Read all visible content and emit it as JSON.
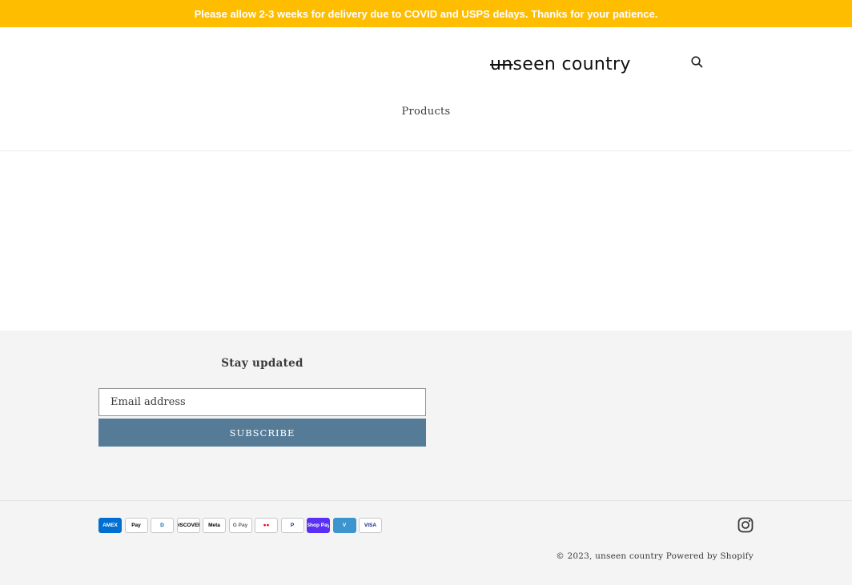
{
  "announcement": {
    "text": "Please allow 2-3 weeks for delivery due to COVID and USPS delays. Thanks for your patience."
  },
  "header": {
    "logo_prefix": "un",
    "logo_suffix": "seen country",
    "search_icon": "search-icon",
    "nav": [
      {
        "label": "Products"
      }
    ]
  },
  "footer": {
    "newsletter": {
      "title": "Stay updated",
      "email_placeholder": "Email address",
      "subscribe_label": "SUBSCRIBE"
    },
    "payment_methods": [
      {
        "label": "AMEX",
        "name": "American Express",
        "bg": "#016fd0",
        "fg": "#ffffff"
      },
      {
        "label": "Pay",
        "name": "Apple Pay",
        "bg": "#ffffff",
        "fg": "#000000"
      },
      {
        "label": "D",
        "name": "Diners Club",
        "bg": "#ffffff",
        "fg": "#0165ac"
      },
      {
        "label": "DISCOVER",
        "name": "Discover",
        "bg": "#ffffff",
        "fg": "#000000"
      },
      {
        "label": "Meta",
        "name": "Meta Pay",
        "bg": "#ffffff",
        "fg": "#000000"
      },
      {
        "label": "G Pay",
        "name": "Google Pay",
        "bg": "#ffffff",
        "fg": "#5f6368"
      },
      {
        "label": "●●",
        "name": "Mastercard",
        "bg": "#ffffff",
        "fg": "#eb001b"
      },
      {
        "label": "P",
        "name": "PayPal",
        "bg": "#ffffff",
        "fg": "#003087"
      },
      {
        "label": "Shop Pay",
        "name": "Shop Pay",
        "bg": "#5a31f4",
        "fg": "#ffffff"
      },
      {
        "label": "V",
        "name": "Venmo",
        "bg": "#3d95ce",
        "fg": "#ffffff"
      },
      {
        "label": "VISA",
        "name": "Visa",
        "bg": "#ffffff",
        "fg": "#142688"
      }
    ],
    "social_icon": "instagram-icon",
    "copyright_prefix": "© 2023,",
    "store_link": "unseen country",
    "powered_by": "Powered by Shopify"
  },
  "colors": {
    "announcement_bg": "#ffbd00",
    "button_bg": "#557b97",
    "footer_bg": "#f4f4f4"
  }
}
